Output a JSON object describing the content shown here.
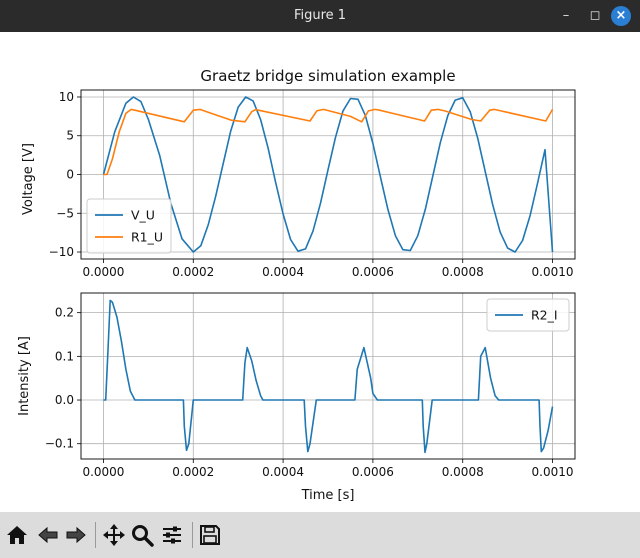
{
  "window": {
    "title": "Figure 1"
  },
  "toolbar": {
    "buttons": [
      {
        "name": "home-icon"
      },
      {
        "name": "back-arrow-icon"
      },
      {
        "name": "forward-arrow-icon"
      },
      {
        "name": "pan-move-icon"
      },
      {
        "name": "zoom-magnifier-icon"
      },
      {
        "name": "configure-subplots-icon"
      },
      {
        "name": "save-floppy-icon"
      }
    ]
  },
  "colors": {
    "series1": "#1f77b4",
    "series2": "#ff7f0e",
    "grid": "#b0b0b0"
  },
  "chart_data": [
    {
      "type": "line",
      "title": "Graetz bridge simulation example",
      "xlabel": "",
      "ylabel": "Voltage [V]",
      "xlim": [
        -5e-05,
        0.00105
      ],
      "ylim": [
        -10.9,
        10.9
      ],
      "xticks": [
        "0.0000",
        "0.0002",
        "0.0004",
        "0.0006",
        "0.0008",
        "0.0010"
      ],
      "xtick_values": [
        0,
        0.0002,
        0.0004,
        0.0006,
        0.0008,
        0.001
      ],
      "yticks": [
        "10",
        "5",
        "0",
        "−5",
        "−10"
      ],
      "ytick_values": [
        10,
        5,
        0,
        -5,
        -10
      ],
      "grid": true,
      "legend_position": "lower-left",
      "series": [
        {
          "name": "V_U",
          "color": "#1f77b4",
          "x": [
            0,
            2.5e-05,
            5e-05,
            6.67e-05,
            8.33e-05,
            0.0001,
            0.000125,
            0.00015,
            0.000175,
            0.0002,
            0.0002167,
            0.0002333,
            0.00025,
            0.0002667,
            0.0002833,
            0.0003,
            0.0003167,
            0.0003333,
            0.00035,
            0.0003667,
            0.0003833,
            0.0004,
            0.0004167,
            0.0004333,
            0.00045,
            0.0004667,
            0.0004833,
            0.0005,
            0.0005167,
            0.0005333,
            0.00055,
            0.0005667,
            0.0005833,
            0.0006,
            0.0006167,
            0.0006333,
            0.00065,
            0.0006667,
            0.0006833,
            0.0007,
            0.0007167,
            0.0007333,
            0.00075,
            0.0007667,
            0.0007833,
            0.0008,
            0.0008167,
            0.0008333,
            0.00085,
            0.0008667,
            0.0008833,
            0.0009,
            0.0009167,
            0.0009333,
            0.00095,
            0.0009667,
            0.0009833,
            0.001
          ],
          "y": [
            0,
            5.5,
            9.2,
            10,
            9.4,
            7.1,
            2.5,
            -3.7,
            -8.3,
            -10,
            -9.2,
            -6.5,
            -2.8,
            1.4,
            5.6,
            8.7,
            10,
            9.5,
            7.1,
            3.4,
            -1.0,
            -5.1,
            -8.4,
            -9.9,
            -9.6,
            -7.3,
            -3.7,
            0.6,
            4.8,
            8.2,
            9.8,
            9.7,
            7.6,
            4.0,
            -0.3,
            -4.5,
            -7.9,
            -9.7,
            -9.8,
            -7.9,
            -4.5,
            -0.2,
            4.1,
            7.6,
            9.6,
            9.9,
            8.1,
            4.7,
            0.4,
            -3.9,
            -7.4,
            -9.5,
            -10,
            -8.5,
            -5.3,
            -1.1,
            3.2,
            -10
          ]
        },
        {
          "name": "R1_U",
          "color": "#ff7f0e",
          "x": [
            0,
            8e-06,
            2e-05,
            3.5e-05,
            5e-05,
            6.2e-05,
            7e-05,
            0.00018,
            0.0002,
            0.000215,
            0.00023,
            0.000285,
            0.000315,
            0.00033,
            0.00034,
            0.000345,
            0.00046,
            0.000475,
            0.00049,
            0.00055,
            0.000575,
            0.00059,
            0.000605,
            0.000615,
            0.000715,
            0.00073,
            0.000745,
            0.00076,
            0.00082,
            0.00084,
            0.00086,
            0.00087,
            0.000985,
            0.001
          ],
          "y": [
            0,
            0,
            2.0,
            5.5,
            7.9,
            8.4,
            8.3,
            6.8,
            8.3,
            8.4,
            8.1,
            7.0,
            6.8,
            8.1,
            8.4,
            8.3,
            6.9,
            8.2,
            8.4,
            7.5,
            6.8,
            8.2,
            8.4,
            8.3,
            6.9,
            8.3,
            8.4,
            8.2,
            7.1,
            6.9,
            8.3,
            8.4,
            6.9,
            8.4
          ]
        }
      ]
    },
    {
      "type": "line",
      "title": "",
      "xlabel": "Time [s]",
      "ylabel": "Intensity [A]",
      "xlim": [
        -5e-05,
        0.00105
      ],
      "ylim": [
        -0.135,
        0.245
      ],
      "xticks": [
        "0.0000",
        "0.0002",
        "0.0004",
        "0.0006",
        "0.0008",
        "0.0010"
      ],
      "xtick_values": [
        0,
        0.0002,
        0.0004,
        0.0006,
        0.0008,
        0.001
      ],
      "yticks": [
        "0.2",
        "0.1",
        "0.0",
        "−0.1"
      ],
      "ytick_values": [
        0.2,
        0.1,
        0,
        -0.1
      ],
      "grid": true,
      "legend_position": "top-right",
      "series": [
        {
          "name": "R2_I",
          "color": "#1f77b4",
          "x": [
            0,
            5e-06,
            1e-05,
            1.5e-05,
            2e-05,
            3e-05,
            4e-05,
            5e-05,
            6e-05,
            7e-05,
            8e-05,
            0.000178,
            0.00018,
            0.000185,
            0.00019,
            0.0002,
            0.00031,
            0.000315,
            0.00032,
            0.00033,
            0.00034,
            0.00035,
            0.000355,
            0.00036,
            0.000447,
            0.00045,
            0.000455,
            0.00046,
            0.000474,
            0.00056,
            0.000565,
            0.00058,
            0.000595,
            0.0006,
            0.00061,
            0.000622,
            0.00071,
            0.000712,
            0.000716,
            0.00072,
            0.000732,
            0.000835,
            0.00084,
            0.00085,
            0.000862,
            0.000872,
            0.00088,
            0.00097,
            0.000972,
            0.000975,
            0.00098,
            0.00099,
            0.001
          ],
          "y": [
            0,
            0,
            0.11,
            0.228,
            0.224,
            0.19,
            0.135,
            0.07,
            0.02,
            0,
            0,
            0,
            -0.06,
            -0.115,
            -0.1,
            0,
            0,
            0.085,
            0.12,
            0.09,
            0.045,
            0.01,
            0,
            0,
            0,
            -0.06,
            -0.118,
            -0.1,
            0,
            0,
            0.07,
            0.12,
            0.05,
            0.015,
            0,
            0,
            0,
            -0.06,
            -0.12,
            -0.1,
            0,
            0,
            0.1,
            0.12,
            0.05,
            0.01,
            0,
            0,
            -0.06,
            -0.118,
            -0.11,
            -0.07,
            -0.015
          ]
        }
      ]
    }
  ]
}
